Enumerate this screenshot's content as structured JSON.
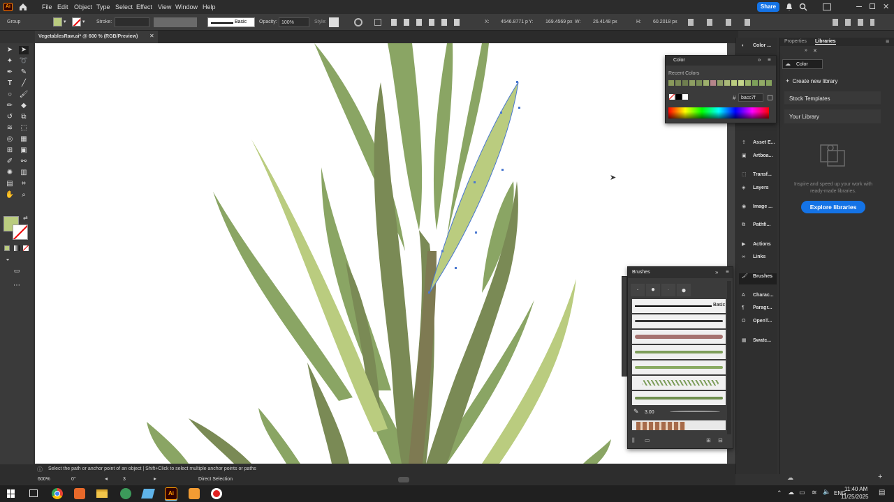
{
  "app": {
    "logo": "Ai",
    "menu": [
      "File",
      "Edit",
      "Object",
      "Type",
      "Select",
      "Effect",
      "View",
      "Window",
      "Help"
    ],
    "share_label": "Share"
  },
  "control": {
    "selection_type": "Group",
    "stroke_label": "Stroke:",
    "brush_name": "Basic",
    "opacity_label": "Opacity:",
    "opacity_value": "100%",
    "style_label": "Style:",
    "x_label": "X:",
    "x_value": "4546.8771 p",
    "y_label": "Y:",
    "y_value": "169.4569 px",
    "w_label": "W:",
    "w_value": "26.4148 px",
    "h_label": "H:",
    "h_value": "60.2018 px",
    "fill_color": "#bacc7f"
  },
  "document": {
    "tab_title": "VegetablesRaw.ai* @ 600 % (RGB/Preview)"
  },
  "panels": {
    "tab_properties": "Properties",
    "tab_libraries": "Libraries",
    "library_dropdown": "Color",
    "create_library": "Create new library",
    "stock_templates": "Stock Templates",
    "your_library": "Your Library",
    "empty_text": "Inspire and speed up your work with ready-made libraries.",
    "explore_button": "Explore libraries"
  },
  "icon_column": [
    {
      "label": "Color ...",
      "icon": "color-icon"
    },
    {
      "label": "Asset E...",
      "icon": "asset-export-icon"
    },
    {
      "label": "Artboa...",
      "icon": "artboards-icon"
    },
    {
      "label": "Transf...",
      "icon": "transform-icon"
    },
    {
      "label": "Layers",
      "icon": "layers-icon"
    },
    {
      "label": "Image ...",
      "icon": "image-trace-icon"
    },
    {
      "label": "Pathfi...",
      "icon": "pathfinder-icon"
    },
    {
      "label": "Actions",
      "icon": "actions-icon"
    },
    {
      "label": "Links",
      "icon": "links-icon"
    },
    {
      "label": "Brushes",
      "icon": "brushes-icon"
    },
    {
      "label": "Charac...",
      "icon": "character-icon"
    },
    {
      "label": "Paragr...",
      "icon": "paragraph-icon"
    },
    {
      "label": "OpenT...",
      "icon": "opentype-icon"
    },
    {
      "label": "Swatc...",
      "icon": "swatches-icon"
    }
  ],
  "color_panel": {
    "title": "Color",
    "recent_label": "Recent Colors",
    "hex_prefix": "#",
    "hex_value": "bacc7f",
    "recent_colors": [
      "#8a9a5b",
      "#7b8a55",
      "#6f7e4f",
      "#8e9f62",
      "#7a8e56",
      "#9db06c",
      "#b5858a",
      "#8f9e66",
      "#aab978",
      "#bacc7f",
      "#c5d68b",
      "#9cb46a",
      "#7ea05a",
      "#92ab66",
      "#86a35d"
    ]
  },
  "brushes_panel": {
    "title": "Brushes",
    "basic_label": "Basic",
    "size_value": "3.00"
  },
  "status": {
    "hint": "Select the path or anchor point of an object  |  Shift+Click to select multiple anchor points or paths",
    "zoom": "600%",
    "rotation": "0°",
    "artboard": "3",
    "tool": "Direct Selection"
  },
  "taskbar": {
    "language": "ENG",
    "time": "11:40 AM",
    "date": "11/25/2025"
  }
}
